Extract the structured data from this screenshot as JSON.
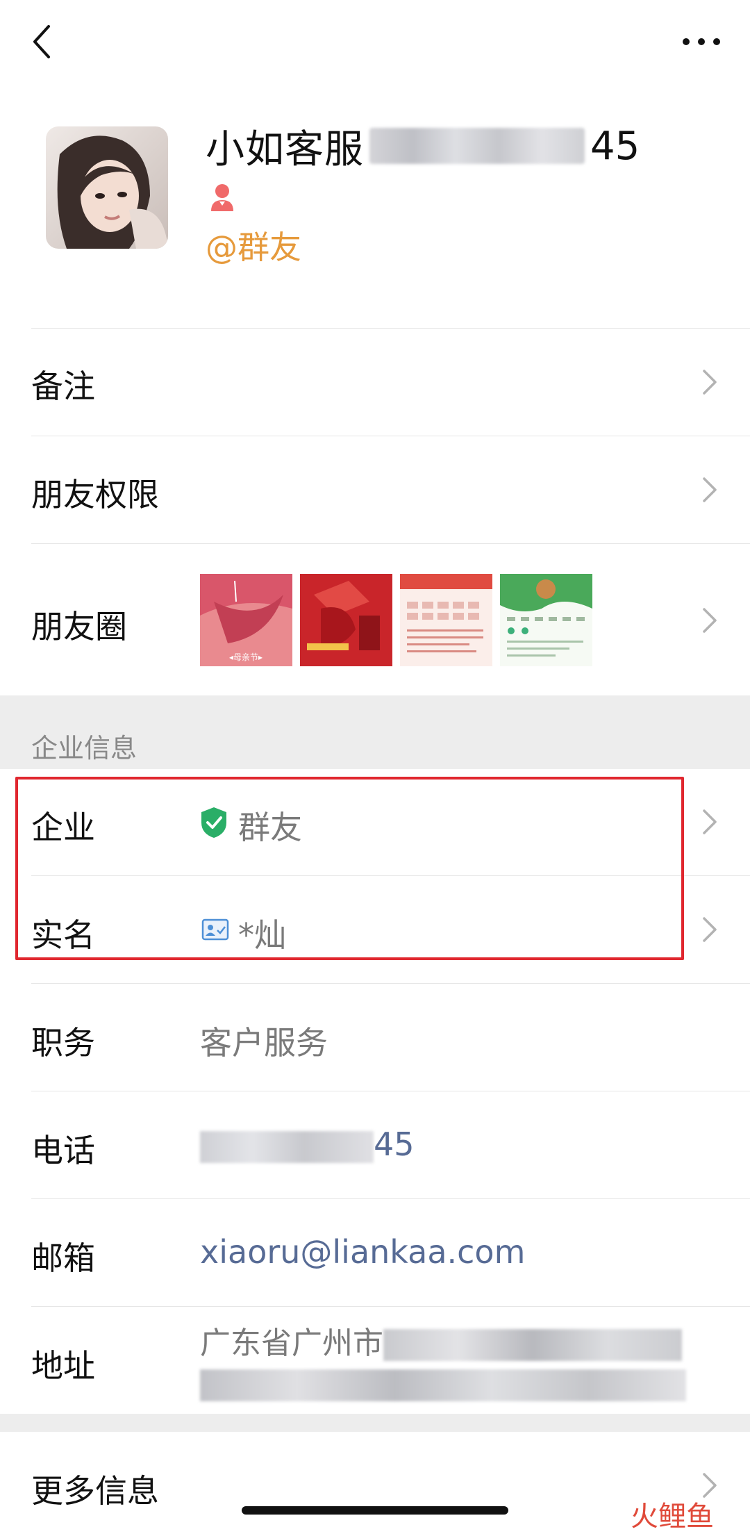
{
  "profile": {
    "name_prefix": "小如客服",
    "name_suffix": "45",
    "org_tag": "@群友"
  },
  "rows": {
    "remark_label": "备注",
    "permissions_label": "朋友权限",
    "moments_label": "朋友圈"
  },
  "moments": {
    "thumb1_caption": "◂母亲节▸"
  },
  "enterprise": {
    "section_title": "企业信息",
    "company_label": "企业",
    "company_value": "群友",
    "realname_label": "实名",
    "realname_value": "*灿",
    "title_label": "职务",
    "title_value": "客户服务",
    "phone_label": "电话",
    "phone_suffix": "45",
    "email_label": "邮箱",
    "email_value": "xiaoru@liankaa.com",
    "address_label": "地址",
    "address_visible": "广东省广州市",
    "more_label": "更多信息"
  },
  "watermark": "火鲤鱼",
  "colors": {
    "org_tag": "#e69a3c",
    "highlight_border": "#e0272f",
    "link": "#576b95",
    "verified_green": "#2aae67"
  }
}
